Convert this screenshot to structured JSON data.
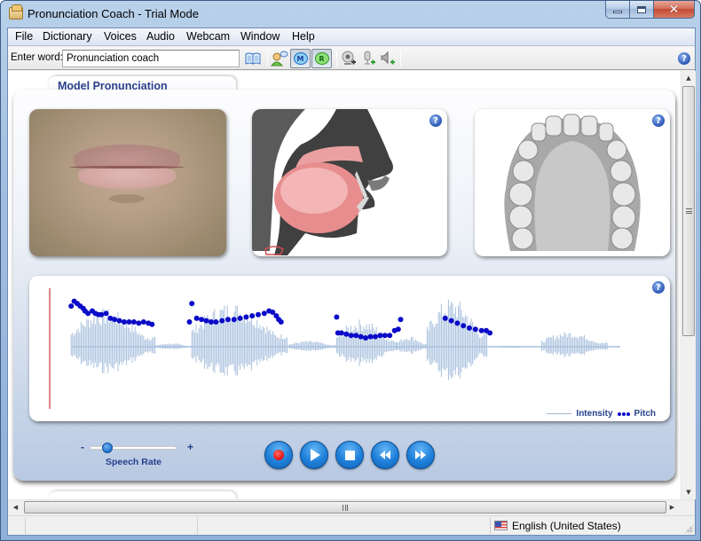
{
  "window": {
    "title": "Pronunciation Coach - Trial Mode",
    "controls": {
      "minimize": "minimize",
      "maximize": "maximize",
      "close": "close"
    }
  },
  "menubar": {
    "items": [
      "File",
      "Dictionary",
      "Voices",
      "Audio",
      "Webcam",
      "Window",
      "Help"
    ]
  },
  "toolbar": {
    "enter_word_label": "Enter word:",
    "word_input_value": "Pronunciation coach",
    "icons": [
      {
        "name": "dictionary-book-icon",
        "glyph": "📖"
      },
      {
        "name": "speaker-voice-icon",
        "glyph": "👤"
      },
      {
        "name": "model-m-toggle",
        "glyph": "M",
        "pressed": true
      },
      {
        "name": "record-r-toggle",
        "glyph": "R",
        "pressed": true
      },
      {
        "name": "add-webcam-icon",
        "glyph": "◎"
      },
      {
        "name": "add-microphone-icon",
        "glyph": "🎙"
      },
      {
        "name": "add-speaker-icon",
        "glyph": "🔈"
      }
    ],
    "help_glyph": "?"
  },
  "panel": {
    "tab_title": "Model Pronunciation",
    "cards": {
      "lips_video": {
        "label": "lips-video"
      },
      "mouth_cross_section": {
        "help_glyph": "?"
      },
      "teeth_palate": {
        "help_glyph": "?"
      },
      "waveform": {
        "help_glyph": "?"
      }
    },
    "legend": {
      "intensity": "Intensity",
      "pitch": "Pitch"
    },
    "speech_rate": {
      "label": "Speech Rate",
      "minus": "-",
      "plus": "+",
      "value_fraction": 0.2
    },
    "playback_buttons": [
      "record",
      "play",
      "stop",
      "rewind",
      "fast-forward"
    ]
  },
  "statusbar": {
    "language": "English (United States)"
  },
  "colors": {
    "accent_text": "#27408b",
    "pitch_dots": "#0a0ac8",
    "intensity_wave": "#a9c0de",
    "cursor_line": "#c0392b",
    "control_button": "#1e7fd8"
  },
  "chart_data": {
    "type": "scatter",
    "title": "",
    "legend": [
      "Intensity",
      "Pitch"
    ],
    "legend_position": "bottom-right",
    "x_range": [
      0,
      100
    ],
    "y_range": [
      0,
      100
    ],
    "intensity_segments": [
      {
        "start": 4,
        "end": 18,
        "amplitude": 0.62
      },
      {
        "start": 18,
        "end": 24,
        "amplitude": 0.06
      },
      {
        "start": 24,
        "end": 40,
        "amplitude": 0.72
      },
      {
        "start": 40,
        "end": 48,
        "amplitude": 0.1
      },
      {
        "start": 48,
        "end": 58,
        "amplitude": 0.45
      },
      {
        "start": 58,
        "end": 63,
        "amplitude": 0.18
      },
      {
        "start": 63,
        "end": 73,
        "amplitude": 0.8
      },
      {
        "start": 73,
        "end": 82,
        "amplitude": 0.02
      },
      {
        "start": 82,
        "end": 93,
        "amplitude": 0.25
      }
    ],
    "pitch_points": [
      [
        4,
        84
      ],
      [
        4.5,
        88
      ],
      [
        5,
        86
      ],
      [
        5.5,
        84
      ],
      [
        6,
        82
      ],
      [
        6.3,
        80
      ],
      [
        6.8,
        78
      ],
      [
        7.5,
        80
      ],
      [
        8,
        78
      ],
      [
        8.5,
        77
      ],
      [
        9,
        77
      ],
      [
        9.8,
        78
      ],
      [
        10.5,
        74
      ],
      [
        11.2,
        73
      ],
      [
        12,
        72
      ],
      [
        12.8,
        71
      ],
      [
        13.6,
        71
      ],
      [
        14.4,
        71
      ],
      [
        15.2,
        70
      ],
      [
        16,
        71
      ],
      [
        16.8,
        70
      ],
      [
        17.4,
        69
      ],
      [
        24,
        86
      ],
      [
        23.6,
        71
      ],
      [
        24.8,
        74
      ],
      [
        25.6,
        73
      ],
      [
        26.4,
        72
      ],
      [
        27.2,
        71
      ],
      [
        28,
        71
      ],
      [
        29,
        72
      ],
      [
        30,
        73
      ],
      [
        31,
        73
      ],
      [
        32,
        74
      ],
      [
        33,
        75
      ],
      [
        34,
        76
      ],
      [
        35,
        77
      ],
      [
        36,
        78
      ],
      [
        36.8,
        80
      ],
      [
        37.4,
        79
      ],
      [
        38,
        76
      ],
      [
        38.4,
        73
      ],
      [
        38.8,
        71
      ],
      [
        48,
        75
      ],
      [
        48.2,
        62
      ],
      [
        48.8,
        62
      ],
      [
        49.6,
        61
      ],
      [
        50.4,
        60
      ],
      [
        51.2,
        60
      ],
      [
        52,
        59
      ],
      [
        52.8,
        58
      ],
      [
        53.6,
        59
      ],
      [
        54.4,
        59
      ],
      [
        55.2,
        60
      ],
      [
        56,
        60
      ],
      [
        56.8,
        60
      ],
      [
        57.6,
        64
      ],
      [
        58.2,
        65
      ],
      [
        58.6,
        73
      ],
      [
        66,
        74
      ],
      [
        67,
        72
      ],
      [
        68,
        70
      ],
      [
        69,
        68
      ],
      [
        70,
        66
      ],
      [
        71,
        65
      ],
      [
        72,
        64
      ],
      [
        72.8,
        64
      ],
      [
        73.4,
        62
      ]
    ],
    "cursor_position": 0
  }
}
